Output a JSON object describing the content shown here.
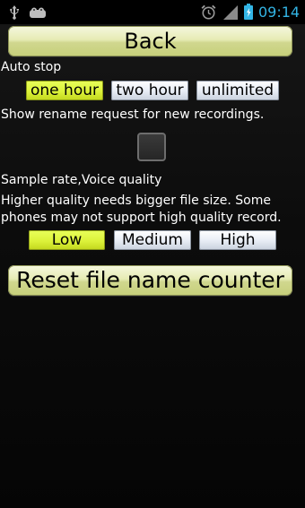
{
  "status_bar": {
    "time": "09:14",
    "icons": [
      "usb-icon",
      "android-icon",
      "alarm-icon",
      "signal-icon",
      "battery-icon"
    ],
    "time_color": "#33b5e5"
  },
  "back_button": {
    "label": "Back"
  },
  "auto_stop": {
    "label": "Auto stop",
    "options": [
      "one hour",
      "two hour",
      "unlimited"
    ],
    "selected": "one hour"
  },
  "rename_request": {
    "label": "Show rename request for new recordings.",
    "checked": false
  },
  "sample_rate": {
    "label": "Sample rate,Voice quality",
    "description_line1": "Higher quality needs bigger file size. Some",
    "description_line2": "phones may not support high quality record.",
    "options": [
      "Low",
      "Medium",
      "High"
    ],
    "selected": "Low"
  },
  "reset_button": {
    "label": "Reset file name counter"
  },
  "colors": {
    "selected_option": "#dcf23a",
    "button": "#e6ebb4",
    "background": "#0c0c0c"
  }
}
